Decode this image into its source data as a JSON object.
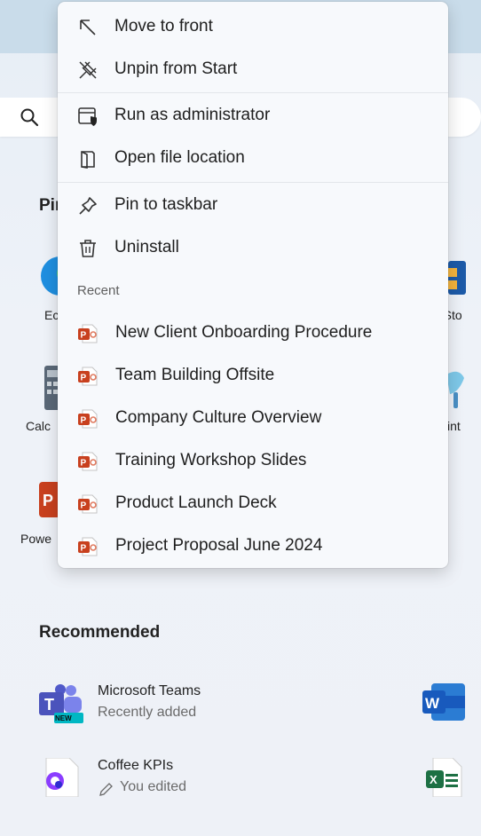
{
  "search": {
    "icon": "search-icon"
  },
  "pinned": {
    "heading": "Pin",
    "apps": [
      {
        "label": "Ec",
        "icon": "edge-icon"
      },
      {
        "label": "ft Sto",
        "icon": "store-icon"
      },
      {
        "label": "Calc",
        "icon": "calculator-icon"
      },
      {
        "label": "int",
        "icon": "paint-icon"
      },
      {
        "label": "Powe",
        "icon": "powerpoint-icon"
      }
    ]
  },
  "context_menu": {
    "items": [
      {
        "label": "Move to front",
        "icon": "move-to-front-icon"
      },
      {
        "label": "Unpin from Start",
        "icon": "unpin-icon"
      },
      {
        "label": "Run as administrator",
        "icon": "run-as-admin-icon"
      },
      {
        "label": "Open file location",
        "icon": "open-folder-icon"
      },
      {
        "label": "Pin to taskbar",
        "icon": "pin-icon"
      },
      {
        "label": "Uninstall",
        "icon": "trash-icon"
      }
    ],
    "recent_label": "Recent",
    "recent": [
      "New Client Onboarding Procedure",
      "Team Building Offsite",
      "Company Culture Overview",
      "Training Workshop Slides",
      "Product Launch Deck",
      "Project Proposal June 2024"
    ]
  },
  "recommended": {
    "heading": "Recommended",
    "items": [
      {
        "title": "Microsoft Teams",
        "subtitle": "Recently added",
        "icon": "teams-icon",
        "badge": "NEW"
      },
      {
        "title": "Coffee KPIs",
        "subtitle": "You edited",
        "icon": "loop-icon"
      }
    ],
    "right_icons": [
      "word-icon",
      "excel-icon"
    ]
  },
  "colors": {
    "accent_ppt": "#c43e1c",
    "menu_bg": "#f7f9fc"
  }
}
